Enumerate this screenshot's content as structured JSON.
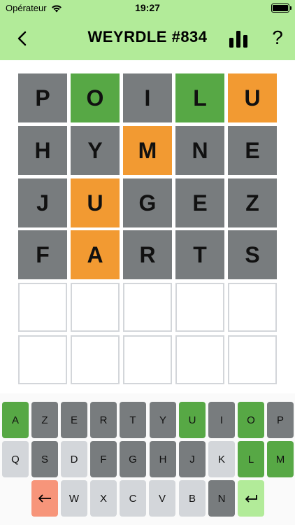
{
  "status": {
    "carrier": "Opérateur",
    "time": "19:27"
  },
  "header": {
    "title": "WEYRDLE #834",
    "help": "?"
  },
  "board": [
    [
      {
        "l": "P",
        "s": "gray"
      },
      {
        "l": "O",
        "s": "green"
      },
      {
        "l": "I",
        "s": "gray"
      },
      {
        "l": "L",
        "s": "green"
      },
      {
        "l": "U",
        "s": "orange"
      }
    ],
    [
      {
        "l": "H",
        "s": "gray"
      },
      {
        "l": "Y",
        "s": "gray"
      },
      {
        "l": "M",
        "s": "orange"
      },
      {
        "l": "N",
        "s": "gray"
      },
      {
        "l": "E",
        "s": "gray"
      }
    ],
    [
      {
        "l": "J",
        "s": "gray"
      },
      {
        "l": "U",
        "s": "orange"
      },
      {
        "l": "G",
        "s": "gray"
      },
      {
        "l": "E",
        "s": "gray"
      },
      {
        "l": "Z",
        "s": "gray"
      }
    ],
    [
      {
        "l": "F",
        "s": "gray"
      },
      {
        "l": "A",
        "s": "orange"
      },
      {
        "l": "R",
        "s": "gray"
      },
      {
        "l": "T",
        "s": "gray"
      },
      {
        "l": "S",
        "s": "gray"
      }
    ],
    [
      {
        "l": "",
        "s": "empty"
      },
      {
        "l": "",
        "s": "empty"
      },
      {
        "l": "",
        "s": "empty"
      },
      {
        "l": "",
        "s": "empty"
      },
      {
        "l": "",
        "s": "empty"
      }
    ],
    [
      {
        "l": "",
        "s": "empty"
      },
      {
        "l": "",
        "s": "empty"
      },
      {
        "l": "",
        "s": "empty"
      },
      {
        "l": "",
        "s": "empty"
      },
      {
        "l": "",
        "s": "empty"
      }
    ]
  ],
  "keyboard": [
    [
      {
        "k": "A",
        "s": "green"
      },
      {
        "k": "Z",
        "s": "gray"
      },
      {
        "k": "E",
        "s": "gray"
      },
      {
        "k": "R",
        "s": "gray"
      },
      {
        "k": "T",
        "s": "gray"
      },
      {
        "k": "Y",
        "s": "gray"
      },
      {
        "k": "U",
        "s": "green"
      },
      {
        "k": "I",
        "s": "gray"
      },
      {
        "k": "O",
        "s": "green"
      },
      {
        "k": "P",
        "s": "gray"
      }
    ],
    [
      {
        "k": "Q",
        "s": "light"
      },
      {
        "k": "S",
        "s": "gray"
      },
      {
        "k": "D",
        "s": "light"
      },
      {
        "k": "F",
        "s": "gray"
      },
      {
        "k": "G",
        "s": "gray"
      },
      {
        "k": "H",
        "s": "gray"
      },
      {
        "k": "J",
        "s": "gray"
      },
      {
        "k": "K",
        "s": "light"
      },
      {
        "k": "L",
        "s": "green"
      },
      {
        "k": "M",
        "s": "green"
      }
    ],
    [
      {
        "k": "←",
        "s": "salmon",
        "name": "backspace"
      },
      {
        "k": "W",
        "s": "light"
      },
      {
        "k": "X",
        "s": "light"
      },
      {
        "k": "C",
        "s": "light"
      },
      {
        "k": "V",
        "s": "light"
      },
      {
        "k": "B",
        "s": "light"
      },
      {
        "k": "N",
        "s": "gray"
      },
      {
        "k": "↵",
        "s": "lightgreen",
        "name": "enter"
      }
    ]
  ],
  "colors": {
    "header": "#b2eb99",
    "gray": "#787c7e",
    "green": "#57a845",
    "orange": "#f29a32",
    "empty_border": "#d3d6da",
    "salmon": "#f7957a"
  }
}
